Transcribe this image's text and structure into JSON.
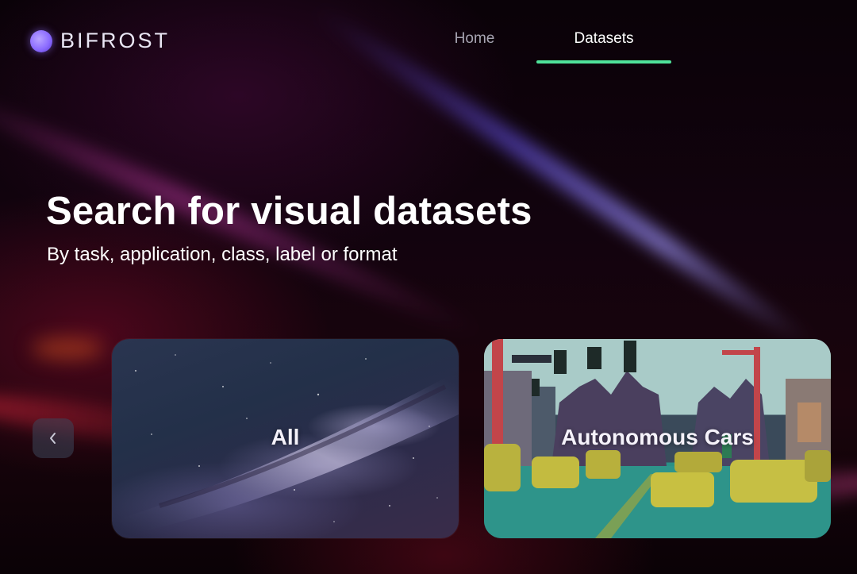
{
  "brand": {
    "name": "BIFROST",
    "logo_color": "#8c6cff"
  },
  "nav": {
    "items": [
      {
        "label": "Home",
        "active": false
      },
      {
        "label": "Datasets",
        "active": true
      }
    ],
    "active_indicator_color": "#4fe39a"
  },
  "hero": {
    "title": "Search for visual datasets",
    "subtitle": "By task, application, class, label or format"
  },
  "carousel": {
    "prev_icon": "chevron-left-icon",
    "cards": [
      {
        "label": "All",
        "image": "milky-way-night-sky"
      },
      {
        "label": "Autonomous Cars",
        "image": "segmented-street-scene"
      }
    ]
  }
}
